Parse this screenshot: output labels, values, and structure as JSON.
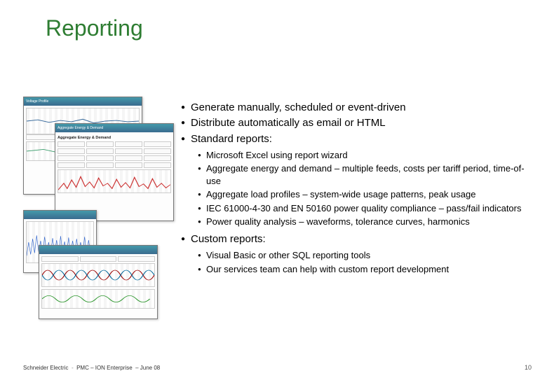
{
  "title": "Reporting",
  "bullets": {
    "m1": "Generate manually, scheduled or event-driven",
    "m2": "Distribute automatically as email or HTML",
    "m3": "Standard reports:",
    "s3_1": "Microsoft Excel using report wizard",
    "s3_2": "Aggregate energy and demand – multiple feeds, costs per tariff period, time-of-use",
    "s3_3": "Aggregate load profiles – system-wide usage patterns, peak usage",
    "s3_4": "IEC 61000-4-30 and EN 50160 power quality compliance – pass/fail indicators",
    "s3_5": "Power quality analysis – waveforms, tolerance curves, harmonics",
    "m4": "Custom reports:",
    "s4_1": "Visual Basic or other SQL reporting tools",
    "s4_2": "Our services team can help with custom report development"
  },
  "footer": {
    "company": "Schneider Electric",
    "sep": "-",
    "product": "PMC – ION Enterprise",
    "date": "– June 08",
    "page": "10"
  },
  "screenshots": {
    "s2_title": "Aggregate Energy & Demand"
  }
}
